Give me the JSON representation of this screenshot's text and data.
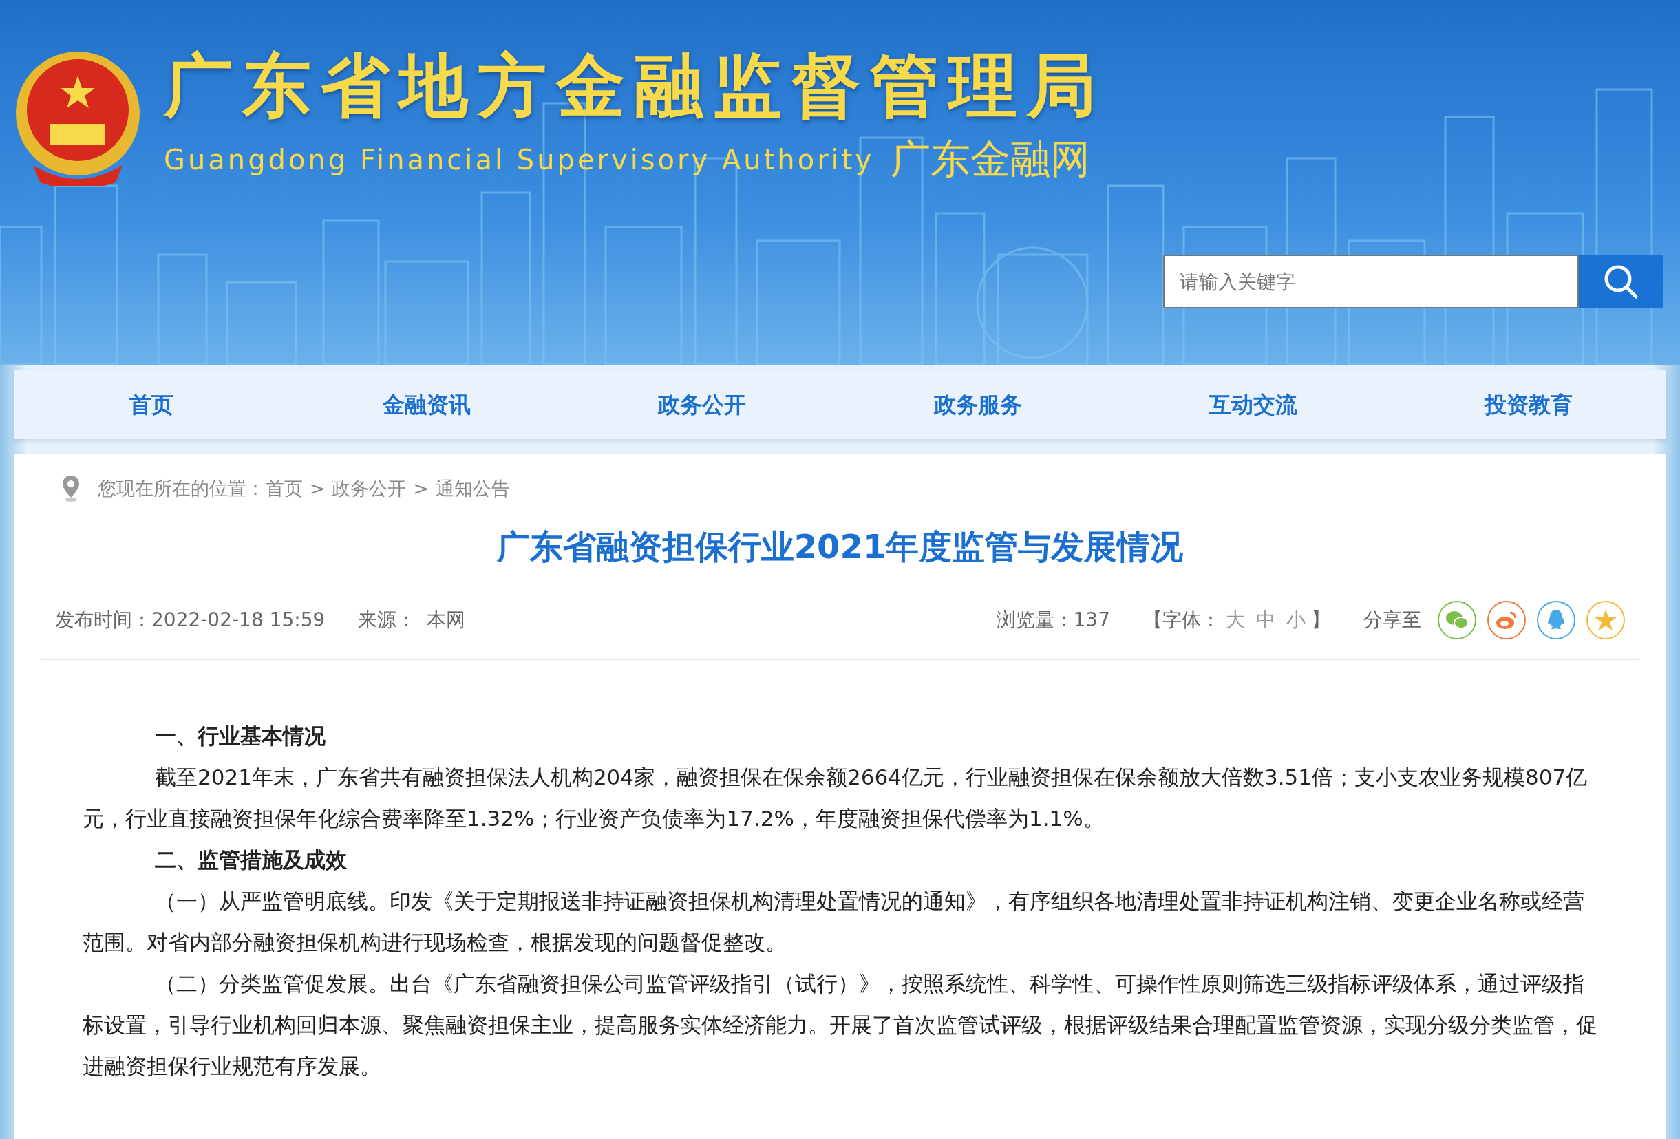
{
  "header": {
    "title": "广东省地方金融监督管理局",
    "subtitle_en": "Guangdong Financial Supervisory Authority",
    "subtitle_cn": "广东金融网",
    "search": {
      "placeholder": "请输入关键字"
    }
  },
  "nav": {
    "items": [
      "首页",
      "金融资讯",
      "政务公开",
      "政务服务",
      "互动交流",
      "投资教育"
    ]
  },
  "breadcrumb": {
    "prefix": "您现在所在的位置 : ",
    "separator": ">",
    "items": [
      "首页",
      "政务公开",
      "通知公告"
    ]
  },
  "article": {
    "title": "广东省融资担保行业2021年度监管与发展情况",
    "meta": {
      "published_label": "发布时间：",
      "published": "2022-02-18 15:59",
      "source_label": "来源：",
      "source": "本网",
      "views_label": "浏览量：",
      "views": "137",
      "font_open": "【字体：",
      "font_sizes": [
        "大",
        "中",
        "小"
      ],
      "font_close": "】",
      "share_label": "分享至",
      "share": [
        {
          "kind": "wechat",
          "color": "#7cbf4a"
        },
        {
          "kind": "weibo",
          "color": "#f07a3c"
        },
        {
          "kind": "qq",
          "color": "#4aa8e8"
        },
        {
          "kind": "qzone",
          "color": "#f5b93a"
        }
      ]
    },
    "paragraphs": [
      {
        "kind": "heading",
        "text": "一、行业基本情况"
      },
      {
        "kind": "body",
        "text": "截至2021年末，广东省共有融资担保法人机构204家，融资担保在保余额2664亿元，行业融资担保在保余额放大倍数3.51倍；支小支农业务规模807亿元，行业直接融资担保年化综合费率降至1.32%；行业资产负债率为17.2%，年度融资担保代偿率为1.1%。"
      },
      {
        "kind": "heading",
        "text": "二、监管措施及成效"
      },
      {
        "kind": "body",
        "text": "（一）从严监管明底线。印发《关于定期报送非持证融资担保机构清理处置情况的通知》，有序组织各地清理处置非持证机构注销、变更企业名称或经营范围。对省内部分融资担保机构进行现场检查，根据发现的问题督促整改。"
      },
      {
        "kind": "body",
        "text": "（二）分类监管促发展。出台《广东省融资担保公司监管评级指引（试行）》，按照系统性、科学性、可操作性原则筛选三级指标评级体系，通过评级指标设置，引导行业机构回归本源、聚焦融资担保主业，提高服务实体经济能力。开展了首次监管试评级，根据评级结果合理配置监管资源，实现分级分类监管，促进融资担保行业规范有序发展。"
      }
    ]
  }
}
